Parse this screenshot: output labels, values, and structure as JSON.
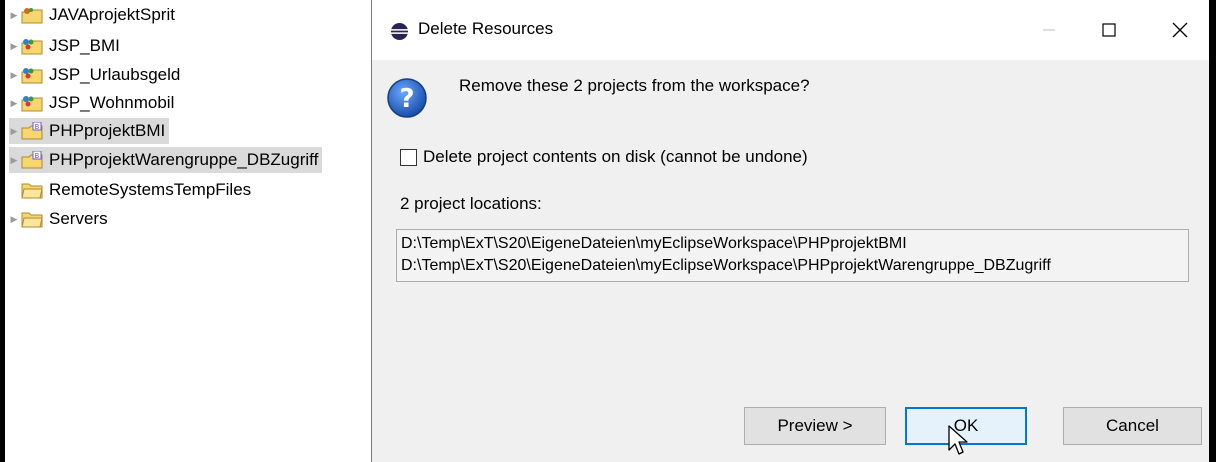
{
  "explorer": {
    "items": [
      {
        "label": "JAVAprojektSprit",
        "icon": "java-project-icon",
        "twisty": true,
        "selected": false
      },
      {
        "label": "JSP_BMI",
        "icon": "web-project-icon",
        "twisty": true,
        "selected": false
      },
      {
        "label": "JSP_Urlaubsgeld",
        "icon": "web-project-icon",
        "twisty": true,
        "selected": false
      },
      {
        "label": "JSP_Wohnmobil",
        "icon": "web-project-icon",
        "twisty": true,
        "selected": false
      },
      {
        "label": "PHPprojektBMI",
        "icon": "php-project-icon",
        "twisty": true,
        "selected": true
      },
      {
        "label": "PHPprojektWarengruppe_DBZugriff",
        "icon": "php-project-icon",
        "twisty": true,
        "selected": true
      },
      {
        "label": "RemoteSystemsTempFiles",
        "icon": "folder-icon",
        "twisty": false,
        "selected": false
      },
      {
        "label": "Servers",
        "icon": "folder-icon",
        "twisty": true,
        "selected": false
      }
    ]
  },
  "dialog": {
    "title": "Delete Resources",
    "message": "Remove these 2 projects from the workspace?",
    "checkbox_label": "Delete project contents on disk (cannot be undone)",
    "checkbox_checked": false,
    "locations_heading": "2 project locations:",
    "locations": [
      "D:\\Temp\\ExT\\S20\\EigeneDateien\\myEclipseWorkspace\\PHPprojektBMI",
      "D:\\Temp\\ExT\\S20\\EigeneDateien\\myEclipseWorkspace\\PHPprojektWarengruppe_DBZugriff"
    ],
    "buttons": {
      "preview": "Preview >",
      "ok": "OK",
      "cancel": "Cancel"
    }
  },
  "colors": {
    "selection": "#dadada",
    "dialog_bg": "#f0f0f0",
    "default_button_border": "#0078d7",
    "question_icon": "#1f5fb5"
  }
}
